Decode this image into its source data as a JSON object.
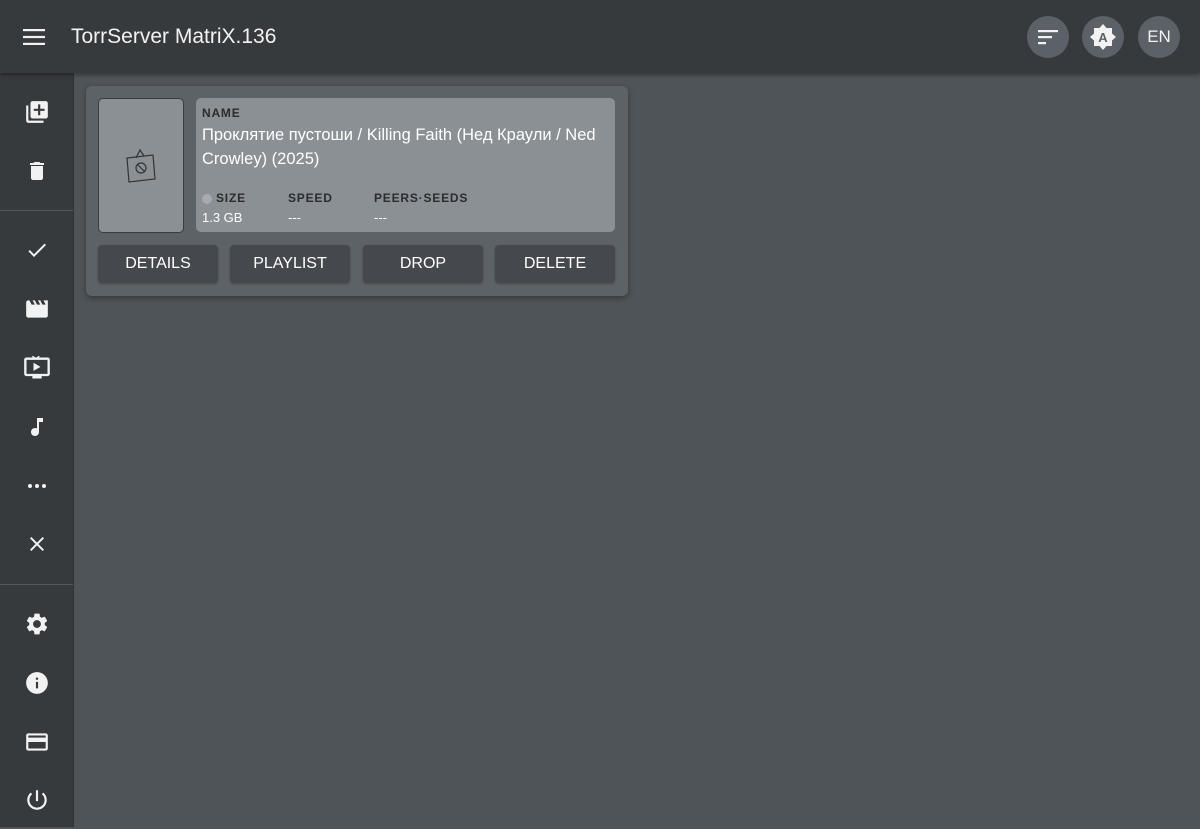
{
  "app": {
    "title": "TorrServer MatriX.136"
  },
  "header_actions": {
    "sort_icon": "sort-icon",
    "theme_icon": "brightness-auto-icon",
    "language_label": "EN"
  },
  "sidebar": {
    "items": [
      {
        "icon": "add-library-icon",
        "name": "add-torrent"
      },
      {
        "icon": "trash-icon",
        "name": "remove-all"
      },
      {
        "icon": "check-icon",
        "name": "filter-all"
      },
      {
        "icon": "movie-icon",
        "name": "filter-movies"
      },
      {
        "icon": "tv-icon",
        "name": "filter-series"
      },
      {
        "icon": "music-icon",
        "name": "filter-music"
      },
      {
        "icon": "more-icon",
        "name": "filter-other"
      },
      {
        "icon": "close-icon",
        "name": "close-torrents"
      },
      {
        "icon": "gear-icon",
        "name": "settings"
      },
      {
        "icon": "info-icon",
        "name": "about"
      },
      {
        "icon": "card-icon",
        "name": "donate"
      },
      {
        "icon": "power-icon",
        "name": "shutdown"
      }
    ]
  },
  "torrent": {
    "name_label": "NAME",
    "name": "Проклятие пустоши / Killing Faith (Нед Краули / Ned Crowley) (2025)",
    "size_label": "SIZE",
    "size": "1.3 GB",
    "speed_label": "SPEED",
    "speed": "---",
    "peers_label": "PEERS·SEEDS",
    "peers": "---",
    "buttons": {
      "details": "DETAILS",
      "playlist": "PLAYLIST",
      "drop": "DROP",
      "delete": "DELETE"
    },
    "status_color": "#a7abaf"
  },
  "colors": {
    "appbar": "#373a3d",
    "background": "#4f5458",
    "card": "#5d6266",
    "info_panel": "#8b9095",
    "button": "#45494d"
  }
}
